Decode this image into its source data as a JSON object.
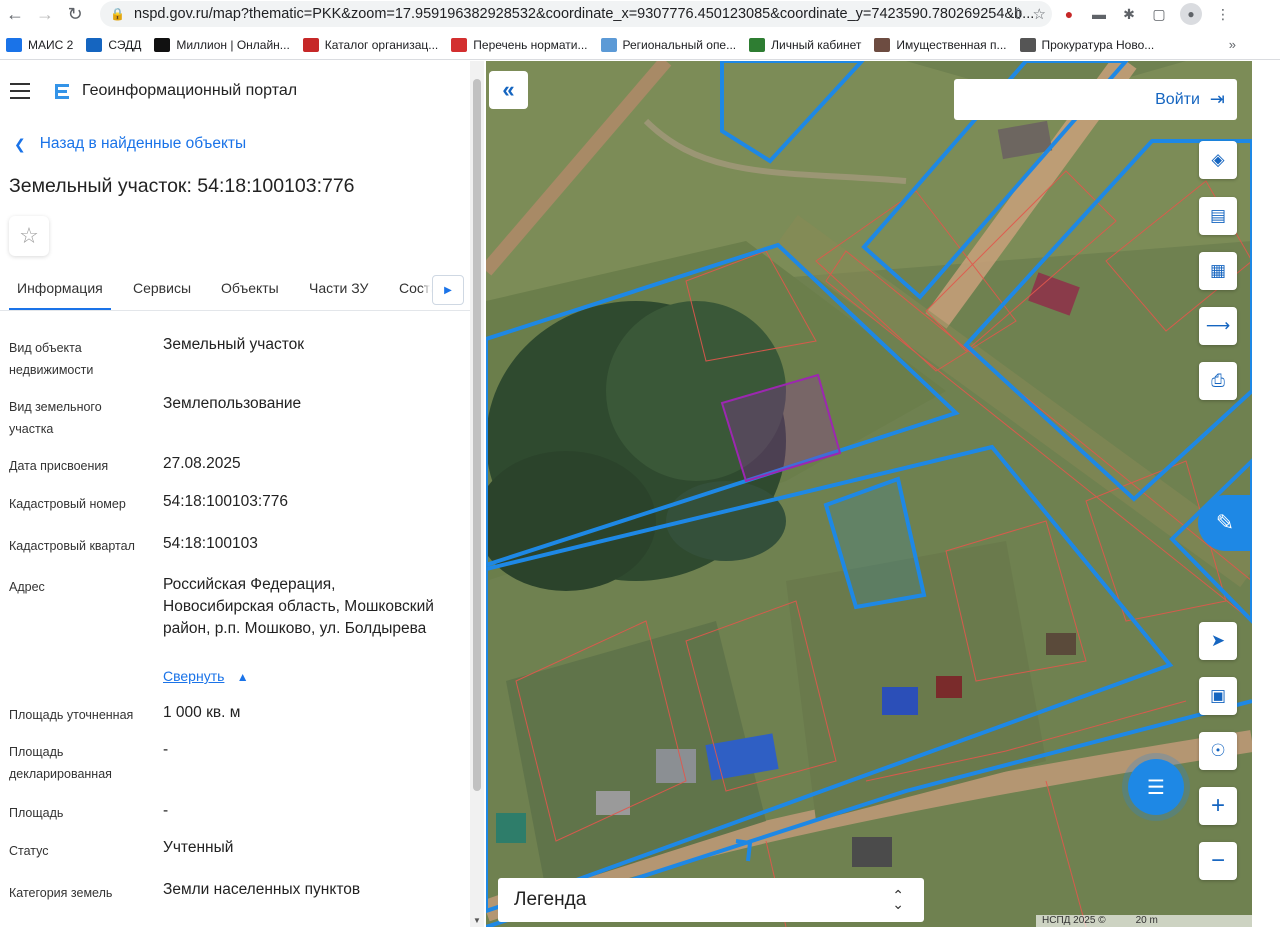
{
  "browser": {
    "url": "nspd.gov.ru/map?thematic=PKK&zoom=17.959196382928532&coordinate_x=9307776.450123085&coordinate_y=7423590.780269254&b...",
    "bookmarks": [
      {
        "label": "МАИС 2",
        "icon": "mais-icon",
        "color": "#1a73e8"
      },
      {
        "label": "СЭДД",
        "icon": "briefcase-icon",
        "color": "#1565c0"
      },
      {
        "label": "Миллион | Онлайн...",
        "icon": "ring-icon",
        "color": "#111111"
      },
      {
        "label": "Каталог организац...",
        "icon": "list-org-icon",
        "color": "#c62828"
      },
      {
        "label": "Перечень нормати...",
        "icon": "shield-icon",
        "color": "#d32f2f"
      },
      {
        "label": "Региональный опе...",
        "icon": "doc-icon",
        "color": "#5c9ad6"
      },
      {
        "label": "Личный кабинет",
        "icon": "emblem-icon",
        "color": "#2e7d32"
      },
      {
        "label": "Имущественная п...",
        "icon": "property-icon",
        "color": "#6d4c41"
      },
      {
        "label": "Прокуратура Ново...",
        "icon": "globe-icon",
        "color": "#555555"
      }
    ],
    "bookmarks_more": "»"
  },
  "portal": {
    "title": "Геоинформационный портал",
    "back_label": "Назад в найденные объекты",
    "object_title": "Земельный участок: 54:18:100103:776",
    "tabs": [
      "Информация",
      "Сервисы",
      "Объекты",
      "Части ЗУ",
      "Соста"
    ],
    "active_tab": "Информация"
  },
  "properties": {
    "object_type": {
      "label": "Вид объекта недвижимости",
      "value": "Земельный участок"
    },
    "land_kind": {
      "label": "Вид земельного участка",
      "value": "Землепользование"
    },
    "assign_date": {
      "label": "Дата присвоения",
      "value": "27.08.2025"
    },
    "cadastral_number": {
      "label": "Кадастровый номер",
      "value": "54:18:100103:776"
    },
    "cadastral_block": {
      "label": "Кадастровый квартал",
      "value": "54:18:100103"
    },
    "address": {
      "label": "Адрес",
      "value": "Российская Федерация, Новосибирская область, Мошковский район, р.п. Мошково, ул. Болдырева",
      "collapse_label": "Свернуть"
    },
    "area_specified": {
      "label": "Площадь уточненная",
      "value": "1 000 кв. м"
    },
    "area_declared": {
      "label": "Площадь декларированная",
      "value": "-"
    },
    "area": {
      "label": "Площадь",
      "value": "-"
    },
    "status": {
      "label": "Статус",
      "value": "Учтенный"
    },
    "land_category": {
      "label": "Категория земель",
      "value": "Земли населенных пунктов"
    }
  },
  "map": {
    "login_label": "Войти",
    "legend_label": "Легенда",
    "copyright": "НСПД 2025 ©",
    "scale": "20 m",
    "parcel_color": "#1e88e5",
    "selected_color": "#9c27b0",
    "controls": [
      "layers-icon",
      "ruler-icon",
      "select-area-icon",
      "share-icon",
      "print-icon",
      "locate-icon",
      "minimap-icon",
      "gps-icon",
      "zoom-in-icon",
      "zoom-out-icon"
    ]
  }
}
